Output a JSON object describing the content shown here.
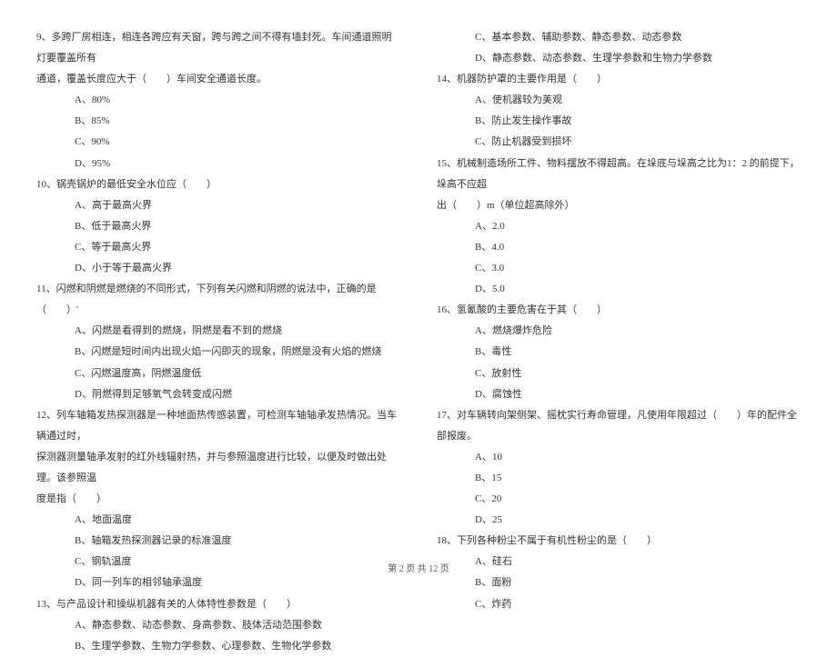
{
  "left": {
    "q9": {
      "line1": "9、多跨厂房相连，相连各跨应有天窗，跨与跨之间不得有墙封死。车间通道照明灯要覆盖所有",
      "line2": "通道，覆盖长度应大于（　　）车间安全通道长度。",
      "a": "A、80%",
      "b": "B、85%",
      "c": "C、90%",
      "d": "D、95%"
    },
    "q10": {
      "line1": "10、锅壳锅炉的最低安全水位应（　　）",
      "a": "A、高于最高火界",
      "b": "B、低于最高火界",
      "c": "C、等于最高火界",
      "d": "D、小于等于最高火界"
    },
    "q11": {
      "line1": "11、闪燃和阴燃是燃烧的不同形式，下列有关闪燃和阴燃的说法中，正确的是（　　）'",
      "a": "A、闪燃是看得到的燃烧，阴燃是看不到的燃烧",
      "b": "B、闪燃是短时间内出现火焰一闪即灭的现象，阴燃是没有火焰的燃烧",
      "c": "C、闪燃温度高，阴燃温度低",
      "d": "D、阴燃得到足够氧气会转变成闪燃"
    },
    "q12": {
      "line1": "12、列车轴箱发热探测器是一种地面热传感装置，可检测车轴轴承发热情况。当车辆通过时，",
      "line2": "探测器测量轴承发射的红外线辐射热，并与参照温度进行比较，以便及时做出处理。该参照温",
      "line3": "度是指（　　）",
      "a": "A、地面温度",
      "b": "B、轴箱发热探测器记录的标准温度",
      "c": "C、钢轨温度",
      "d": "D、同一列车的相邻轴承温度"
    },
    "q13": {
      "line1": "13、与产品设计和操纵机器有关的人体特性参数是（　　）",
      "a": "A、静态参数、动态参数、身高参数、肢体活动范围参数",
      "b": "B、生理学参数、生物力学参数、心理参数、生物化学参数"
    }
  },
  "right": {
    "q13": {
      "c": "C、基本参数、辅助参数、静态参数、动态参数",
      "d": "D、静态参数、动态参数、生理学参数和生物力学参数"
    },
    "q14": {
      "line1": "14、机器防护罩的主要作用是（　　）",
      "a": "A、使机器较为美观",
      "b": "B、防止发生操作事故",
      "c": "C、防止机器受到损坏"
    },
    "q15": {
      "line1": "15、机械制造场所工件、物料摆放不得超高。在垛底与垛高之比为1：2 的前提下，垛高不应超",
      "line2": "出（　　）m（单位超高除外）",
      "a": "A、2.0",
      "b": "B、4.0",
      "c": "C、3.0",
      "d": "D、5.0"
    },
    "q16": {
      "line1": "16、氢氰酸的主要危害在于其（　　）",
      "a": "A、燃烧爆炸危险",
      "b": "B、毒性",
      "c": "C、放射性",
      "d": "D、腐蚀性"
    },
    "q17": {
      "line1": "17、对车辆转向架侧架、摇枕实行寿命管理，凡使用年限超过（　　）年的配件全部报废。",
      "a": "A、10",
      "b": "B、15",
      "c": "C、20",
      "d": "D、25"
    },
    "q18": {
      "line1": "18、下列各种粉尘不属于有机性粉尘的是（　　）",
      "a": "A、硅石",
      "b": "B、面粉",
      "c": "C、炸药"
    }
  },
  "footer": "第 2 页 共 12 页"
}
